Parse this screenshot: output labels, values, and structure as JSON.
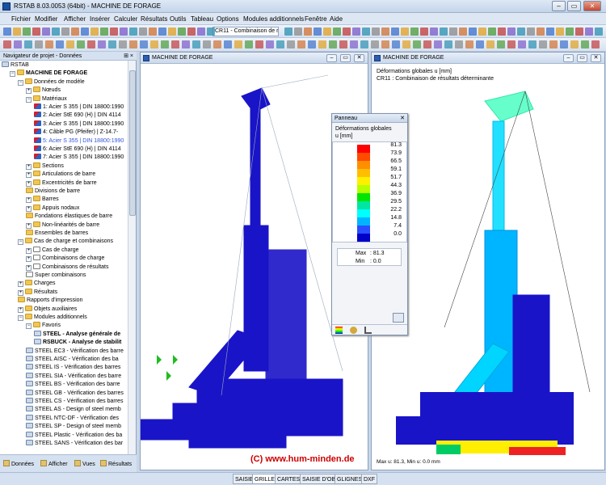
{
  "app": {
    "title": "RSTAB 8.03.0053 (64bit) - MACHINE DE FORAGE"
  },
  "menu": [
    "Fichier",
    "Modifier",
    "Afficher",
    "Insérer",
    "Calculer",
    "Résultats",
    "Outils",
    "Tableau",
    "Options",
    "Modules additionnels",
    "Fenêtre",
    "Aide"
  ],
  "toolbar": {
    "load_combo": "CR11 - Combinaison de ré"
  },
  "navigator": {
    "title": "Navigateur de projet - Données",
    "pin": "⊞ ×",
    "items": [
      {
        "label": "RSTAB",
        "level": 0,
        "icon": "mod",
        "exp": ""
      },
      {
        "label": "MACHINE DE FORAGE",
        "level": 1,
        "icon": "folder",
        "exp": "−",
        "bold": true
      },
      {
        "label": "Données de modèle",
        "level": 2,
        "icon": "folder",
        "exp": "−"
      },
      {
        "label": "Nœuds",
        "level": 3,
        "icon": "folder",
        "exp": "+"
      },
      {
        "label": "Matériaux",
        "level": 3,
        "icon": "folder",
        "exp": "−"
      },
      {
        "label": "1: Acier S 355 | DIN 18800:1990",
        "level": 4,
        "icon": "mat",
        "exp": ""
      },
      {
        "label": "2: Acier StE 690 (H) | DIN 4114",
        "level": 4,
        "icon": "mat",
        "exp": ""
      },
      {
        "label": "3: Acier S 355 | DIN 18800:1990",
        "level": 4,
        "icon": "mat",
        "exp": ""
      },
      {
        "label": "4: Câble PG (Pfeifer) | Z-14.7-",
        "level": 4,
        "icon": "mat",
        "exp": ""
      },
      {
        "label": "5: Acier S 355 | DIN 18800:1990",
        "level": 4,
        "icon": "mat",
        "exp": "",
        "blue": true
      },
      {
        "label": "6: Acier StE 690 (H) | DIN 4114",
        "level": 4,
        "icon": "mat",
        "exp": ""
      },
      {
        "label": "7: Acier S 355 | DIN 18800:1990",
        "level": 4,
        "icon": "mat",
        "exp": ""
      },
      {
        "label": "Sections",
        "level": 3,
        "icon": "folder",
        "exp": "+"
      },
      {
        "label": "Articulations de barre",
        "level": 3,
        "icon": "folder",
        "exp": "+"
      },
      {
        "label": "Excentricités de barre",
        "level": 3,
        "icon": "folder",
        "exp": "+"
      },
      {
        "label": "Divisions de barre",
        "level": 3,
        "icon": "folder",
        "exp": ""
      },
      {
        "label": "Barres",
        "level": 3,
        "icon": "folder",
        "exp": "+"
      },
      {
        "label": "Appuis nodaux",
        "level": 3,
        "icon": "folder",
        "exp": "+"
      },
      {
        "label": "Fondations élastiques de barre",
        "level": 3,
        "icon": "folder",
        "exp": ""
      },
      {
        "label": "Non-linéarités de barre",
        "level": 3,
        "icon": "folder",
        "exp": "+"
      },
      {
        "label": "Ensembles de barres",
        "level": 3,
        "icon": "folder",
        "exp": ""
      },
      {
        "label": "Cas de charge et combinaisons",
        "level": 2,
        "icon": "folder",
        "exp": "−"
      },
      {
        "label": "Cas de charge",
        "level": 3,
        "icon": "doc",
        "exp": "+"
      },
      {
        "label": "Combinaisons de charge",
        "level": 3,
        "icon": "doc",
        "exp": "+"
      },
      {
        "label": "Combinaisons de résultats",
        "level": 3,
        "icon": "doc",
        "exp": "+"
      },
      {
        "label": "Super combinaisons",
        "level": 3,
        "icon": "doc",
        "exp": ""
      },
      {
        "label": "Charges",
        "level": 2,
        "icon": "folder",
        "exp": "+"
      },
      {
        "label": "Résultats",
        "level": 2,
        "icon": "folder",
        "exp": "+"
      },
      {
        "label": "Rapports d'impression",
        "level": 2,
        "icon": "folder",
        "exp": ""
      },
      {
        "label": "Objets auxiliaires",
        "level": 2,
        "icon": "folder",
        "exp": "+"
      },
      {
        "label": "Modules additionnels",
        "level": 2,
        "icon": "folder",
        "exp": "−"
      },
      {
        "label": "Favoris",
        "level": 3,
        "icon": "folder",
        "exp": "−"
      },
      {
        "label": "STEEL - Analyse générale de",
        "level": 4,
        "icon": "mod",
        "exp": "",
        "bold": true
      },
      {
        "label": "RSBUCK - Analyse de stabilit",
        "level": 4,
        "icon": "mod",
        "exp": "",
        "bold": true
      },
      {
        "label": "STEEL EC3 - Vérification des barre",
        "level": 3,
        "icon": "mod",
        "exp": ""
      },
      {
        "label": "STEEL AISC - Vérification des ba",
        "level": 3,
        "icon": "mod",
        "exp": ""
      },
      {
        "label": "STEEL IS - Vérification des barres",
        "level": 3,
        "icon": "mod",
        "exp": ""
      },
      {
        "label": "STEEL SIA - Vérification des barre",
        "level": 3,
        "icon": "mod",
        "exp": ""
      },
      {
        "label": "STEEL BS - Vérification des barre",
        "level": 3,
        "icon": "mod",
        "exp": ""
      },
      {
        "label": "STEEL GB - Vérification des barres",
        "level": 3,
        "icon": "mod",
        "exp": ""
      },
      {
        "label": "STEEL CS - Vérification des barres",
        "level": 3,
        "icon": "mod",
        "exp": ""
      },
      {
        "label": "STEEL AS - Design of steel memb",
        "level": 3,
        "icon": "mod",
        "exp": ""
      },
      {
        "label": "STEEL NTC-DF - Vérification des",
        "level": 3,
        "icon": "mod",
        "exp": ""
      },
      {
        "label": "STEEL SP - Design of steel memb",
        "level": 3,
        "icon": "mod",
        "exp": ""
      },
      {
        "label": "STEEL Plastic - Vérification des ba",
        "level": 3,
        "icon": "mod",
        "exp": ""
      },
      {
        "label": "STEEL SANS - Vérification des bar",
        "level": 3,
        "icon": "mod",
        "exp": ""
      }
    ],
    "tabs": [
      "Données",
      "Afficher",
      "Vues",
      "Résultats"
    ]
  },
  "view_left": {
    "title": "MACHINE DE FORAGE"
  },
  "view_right": {
    "title": "MACHINE DE FORAGE",
    "info1": "Déformations globales u [mm]",
    "info2": "CR11 : Combinaison de résultats déterminante",
    "footer": "Max u: 81.3, Min u: 0.0 mm"
  },
  "panel": {
    "title": "Panneau",
    "label": "Déformations globales",
    "unit": "u [mm]",
    "ticks": [
      "81.3",
      "73.9",
      "66.5",
      "59.1",
      "51.7",
      "44.3",
      "36.9",
      "29.5",
      "22.2",
      "14.8",
      "7.4",
      "0.0"
    ],
    "colors": [
      "#ff0000",
      "#ff4a00",
      "#ff8f00",
      "#ffbf00",
      "#fff000",
      "#b5ff00",
      "#00e600",
      "#00e6a0",
      "#00ffff",
      "#00b5ff",
      "#2a4dff",
      "#0000c8"
    ],
    "max_label": "Max",
    "max_val": ":  81.3",
    "min_label": "Min",
    "min_val": ":    0.0"
  },
  "statusbar": [
    "SAISIE",
    "GRILLE",
    "CARTES",
    "SAISIE D'OB",
    "GLIGNES",
    "DXF"
  ],
  "watermark": "(C) www.hum-minden.de"
}
